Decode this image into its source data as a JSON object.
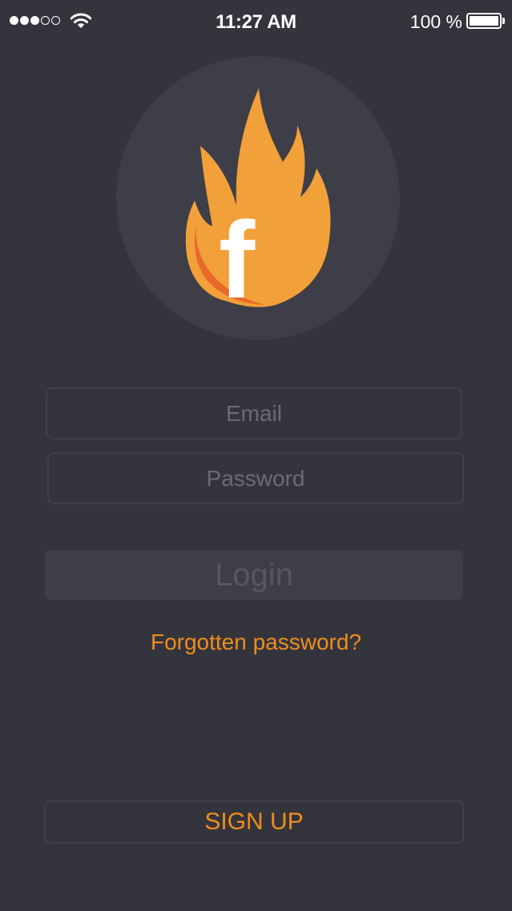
{
  "status_bar": {
    "time": "11:27 AM",
    "battery_percent": "100 %",
    "signal_filled": 3,
    "signal_total": 5
  },
  "logo": {
    "icon": "flame-icon",
    "letter": "f",
    "colors": {
      "flame": "#f2a03a",
      "flame_shadow": "#e8692c",
      "circle": "#3d3e47"
    }
  },
  "form": {
    "email_placeholder": "Email",
    "password_placeholder": "Password",
    "login_label": "Login"
  },
  "links": {
    "forgot_password": "Forgotten password?"
  },
  "signup": {
    "label": "SIGN UP"
  },
  "colors": {
    "background": "#34343d",
    "accent": "#ee8e1c"
  }
}
